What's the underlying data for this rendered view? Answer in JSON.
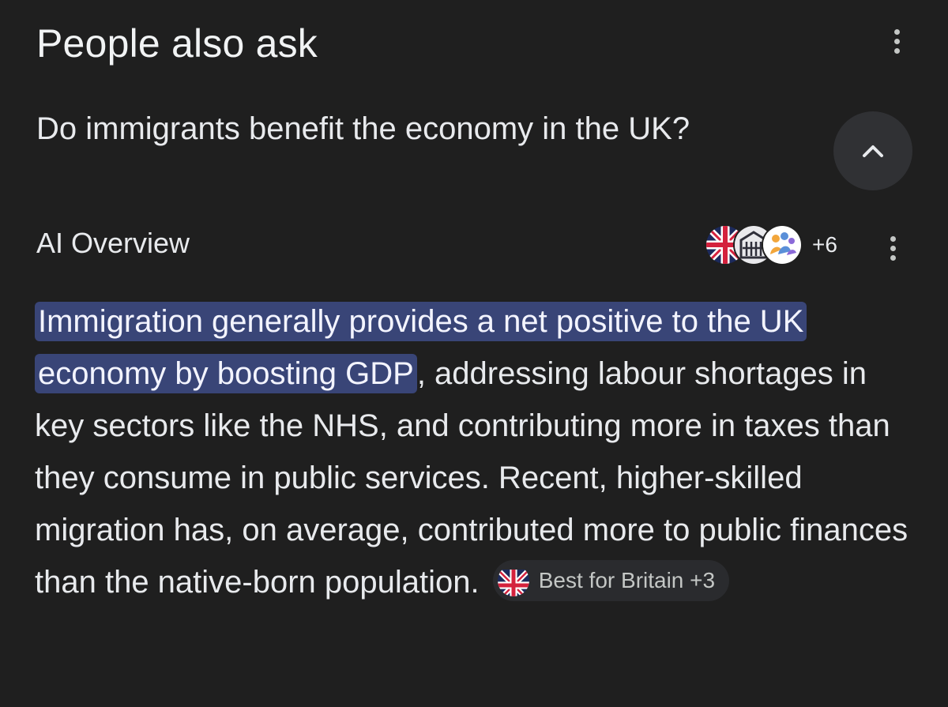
{
  "section": {
    "title": "People also ask"
  },
  "question": {
    "text": "Do immigrants benefit the economy in the UK?"
  },
  "ai_overview": {
    "label": "AI Overview",
    "sources_more": "+6",
    "source_icons": [
      "flag-icon",
      "parliament-icon",
      "people-icon"
    ],
    "answer": {
      "highlighted": "Immigration generally provides a net positive to the UK economy by boosting GDP",
      "rest": ", addressing labour shortages in key sectors like the NHS, and contributing more in taxes than they consume in public services. Recent, higher-skilled migration has, on average, contributed more to public finances than the native-born population. "
    },
    "citation": {
      "label": "Best for Britain +3"
    }
  },
  "colors": {
    "background": "#1f1f1f",
    "highlight": "#394577",
    "chip": "#2a2b2e",
    "button": "#303134"
  }
}
